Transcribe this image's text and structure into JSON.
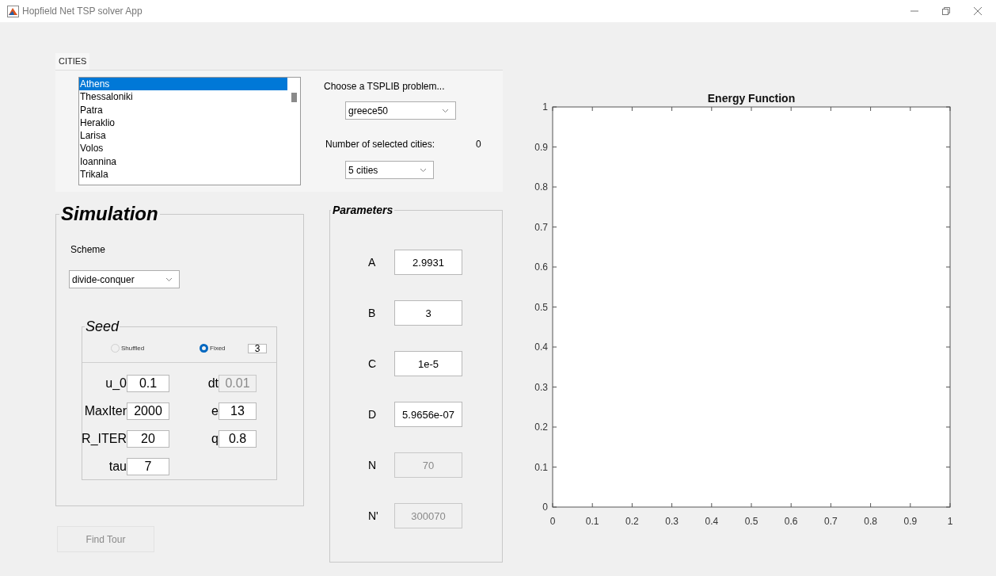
{
  "window": {
    "title": "Hopfield Net TSP solver App"
  },
  "cities_panel": {
    "tab": {
      "label": "CITIES",
      "selected": true
    },
    "cities": [
      {
        "name": "Athens",
        "selected": true
      },
      {
        "name": "Thessaloniki",
        "selected": false
      },
      {
        "name": "Patra",
        "selected": false
      },
      {
        "name": "Heraklio",
        "selected": false
      },
      {
        "name": "Larisa",
        "selected": false
      },
      {
        "name": "Volos",
        "selected": false
      },
      {
        "name": "Ioannina",
        "selected": false
      },
      {
        "name": "Trikala",
        "selected": false
      }
    ],
    "problem_label": "Choose a TSPLIB problem...",
    "problem": {
      "value": "greece50"
    },
    "count_label": "Number of selected cities:",
    "count": "0",
    "cities_dropdown": {
      "value": "5 cities"
    }
  },
  "simulation": {
    "title": "Simulation",
    "scheme_label": "Scheme",
    "scheme": {
      "value": "divide-conquer"
    },
    "seed": {
      "title": "Seed",
      "options": [
        {
          "label": "Shuffled",
          "selected": false
        },
        {
          "label": "Fixed",
          "selected": true
        }
      ],
      "seed_value": "3",
      "fields": [
        {
          "label": "u_0",
          "value": "0.1",
          "disabled": false
        },
        {
          "label": "dt",
          "value": "0.01",
          "disabled": true
        },
        {
          "label": "MaxIter",
          "value": "2000",
          "disabled": false
        },
        {
          "label": "e",
          "value": "13",
          "disabled": false
        },
        {
          "label": "R_ITER",
          "value": "20",
          "disabled": false
        },
        {
          "label": "q",
          "value": "0.8",
          "disabled": false
        },
        {
          "label": "tau",
          "value": "7",
          "disabled": false
        }
      ]
    }
  },
  "find_tour": {
    "label": "Find Tour",
    "disabled": true
  },
  "parameters": {
    "title": "Parameters",
    "fields": [
      {
        "label": "A",
        "value": "2.9931",
        "disabled": false
      },
      {
        "label": "B",
        "value": "3",
        "disabled": false
      },
      {
        "label": "C",
        "value": "1e-5",
        "disabled": false
      },
      {
        "label": "D",
        "value": "5.9656e-07",
        "disabled": false
      },
      {
        "label": "N",
        "value": "70",
        "disabled": true
      },
      {
        "label": "N'",
        "value": "300070",
        "disabled": true
      }
    ]
  },
  "chart": {
    "chart_data": {
      "type": "line",
      "title": "Energy Function",
      "xlim": [
        0,
        1
      ],
      "ylim": [
        0,
        1
      ],
      "xticks": [
        0,
        0.1,
        0.2,
        0.3,
        0.4,
        0.5,
        0.6,
        0.7,
        0.8,
        0.9,
        1
      ],
      "yticks": [
        0,
        0.1,
        0.2,
        0.3,
        0.4,
        0.5,
        0.6,
        0.7,
        0.8,
        0.9,
        1
      ]
    }
  }
}
